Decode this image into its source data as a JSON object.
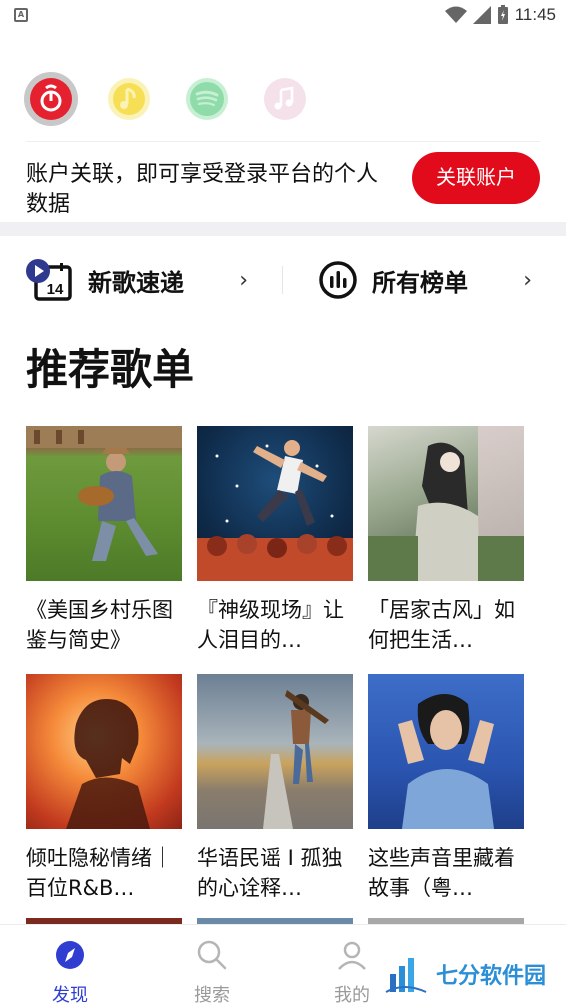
{
  "status_bar": {
    "time": "11:45",
    "notification_glyph": "A"
  },
  "platforms": [
    {
      "name": "netease-icon",
      "color": "#e5202f"
    },
    {
      "name": "qq-music-icon",
      "color": "#fbf2b8"
    },
    {
      "name": "spotify-icon",
      "color": "#c7efd3"
    },
    {
      "name": "apple-music-icon",
      "color": "#f5e1ea"
    }
  ],
  "link_account": {
    "message": "账户关联，即可享受登录平台的个人数据",
    "button_label": "关联账户"
  },
  "quick_entries": {
    "new_songs": "新歌速递",
    "all_charts": "所有榜单",
    "calendar_day": "14"
  },
  "section": {
    "title": "推荐歌单"
  },
  "playlists": [
    {
      "title": "《美国乡村乐图鉴与简史》"
    },
    {
      "title": "『神级现场』让人泪目的…"
    },
    {
      "title": "「居家古风」如何把生活…"
    },
    {
      "title": "倾吐隐秘情绪｜百位R&B…"
    },
    {
      "title": "华语民谣 I 孤独的心诠释…"
    },
    {
      "title": "这些声音里藏着故事（粤…"
    }
  ],
  "bottom_nav": {
    "discover": "发现",
    "search": "搜索",
    "mine": "我的"
  },
  "watermark": {
    "text": "七分软件园"
  },
  "colors": {
    "accent_red": "#e10b1b",
    "nav_active": "#2f3ed1"
  }
}
